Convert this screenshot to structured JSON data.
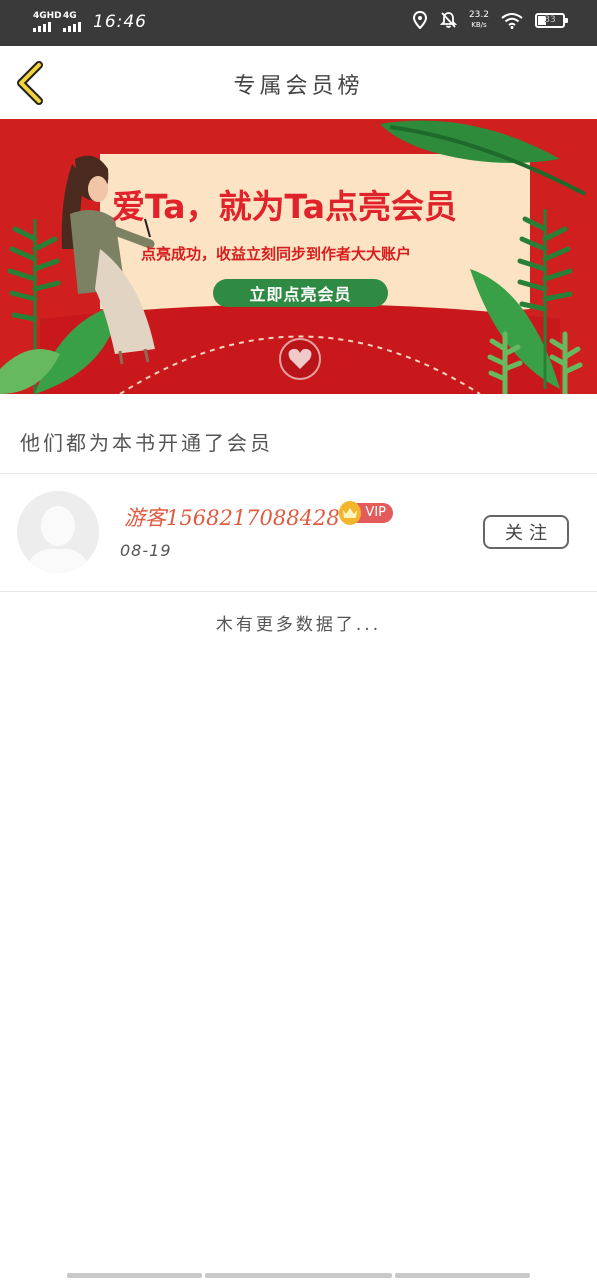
{
  "status_bar": {
    "network1": "4GHD",
    "network2": "4G",
    "time": "16:46",
    "speed_value": "23.2",
    "speed_unit": "KB/s",
    "battery": "33"
  },
  "header": {
    "title": "专属会员榜"
  },
  "banner": {
    "headline": "爱Ta，就为Ta点亮会员",
    "subtitle": "点亮成功，收益立刻同步到作者大大账户",
    "cta_label": "立即点亮会员"
  },
  "section": {
    "heading": "他们都为本书开通了会员"
  },
  "members": [
    {
      "name": "游客15682170884​28",
      "badge": "VIP",
      "date": "08-19",
      "follow_label": "关注"
    }
  ],
  "footer": {
    "no_more": "木有更多数据了..."
  },
  "colors": {
    "accent_red": "#cf1f1f",
    "name_color": "#e05a3f",
    "cta_green": "#2f8a43",
    "vip_gold": "#f3b52b"
  }
}
